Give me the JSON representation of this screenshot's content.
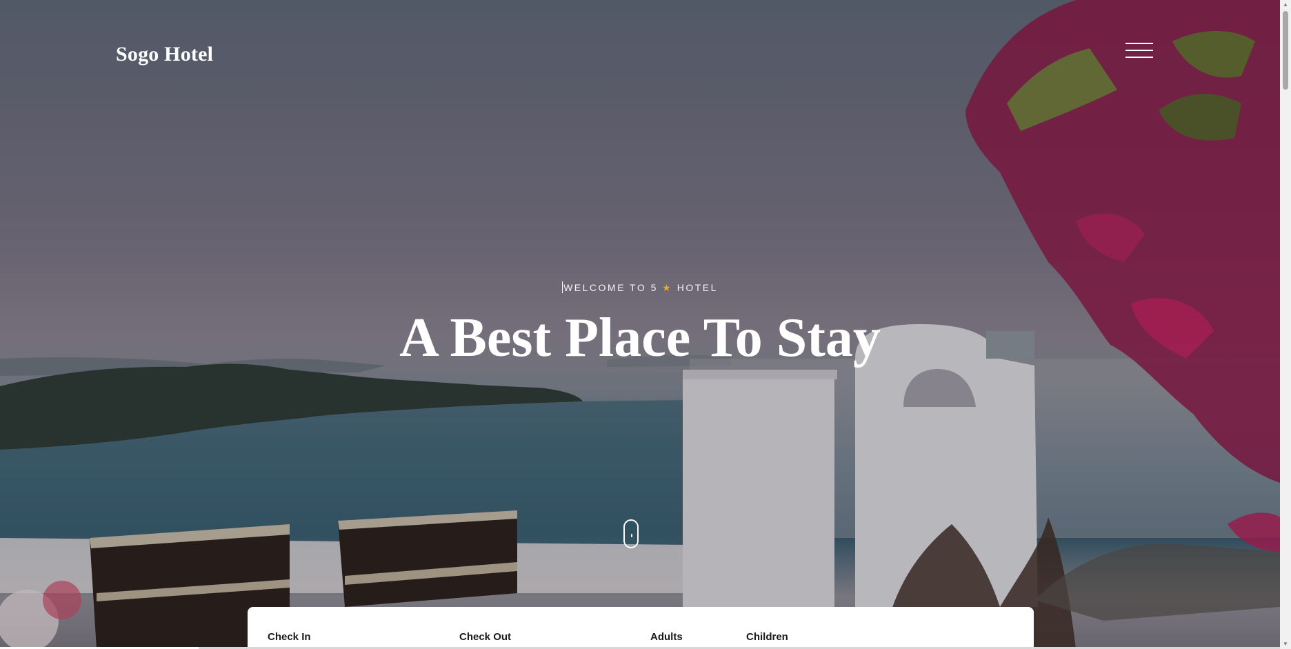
{
  "header": {
    "brand": "Sogo Hotel",
    "menu_icon": "hamburger-menu-icon"
  },
  "hero": {
    "welcome_prefix": "WELCOME TO 5",
    "welcome_star": "★",
    "welcome_suffix": "HOTEL",
    "headline": "A Best Place To Stay",
    "scroll_icon": "mouse-scroll-icon"
  },
  "booking": {
    "check_in_label": "Check In",
    "check_out_label": "Check Out",
    "adults_label": "Adults",
    "children_label": "Children"
  },
  "colors": {
    "star": "#f5a623",
    "text_on_hero": "#ffffff"
  }
}
